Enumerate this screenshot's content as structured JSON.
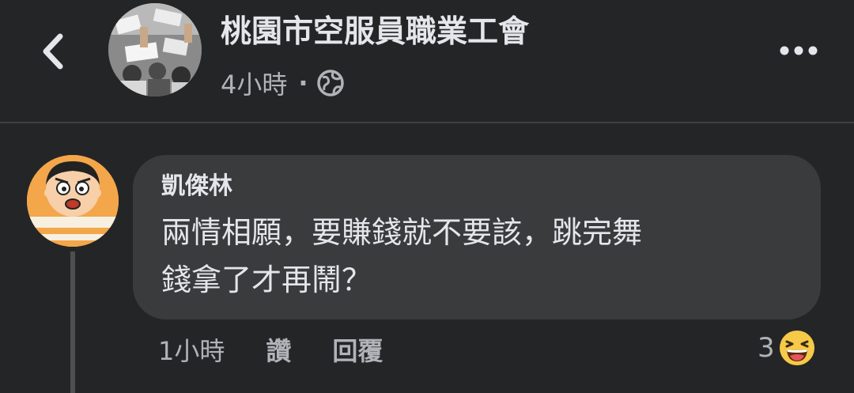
{
  "header": {
    "page_name": "桃園市空服員職業工會",
    "post_time": "4小時",
    "separator": "·",
    "audience_icon": "globe-icon"
  },
  "comment": {
    "author": "凱傑林",
    "text_lines": [
      "兩情相願，要賺錢就不要該，跳完舞",
      "錢拿了才再鬧？"
    ],
    "time": "1小時",
    "like_label": "讚",
    "reply_label": "回覆",
    "reaction_count": "3",
    "reaction_icon": "haha-emoji-icon"
  },
  "colors": {
    "background": "#242526",
    "bubble": "#3a3b3c",
    "primary_text": "#e4e6eb",
    "secondary_text": "#b0b3b8",
    "divider": "#3e4042",
    "reaction_yellow": "#f7c948"
  }
}
